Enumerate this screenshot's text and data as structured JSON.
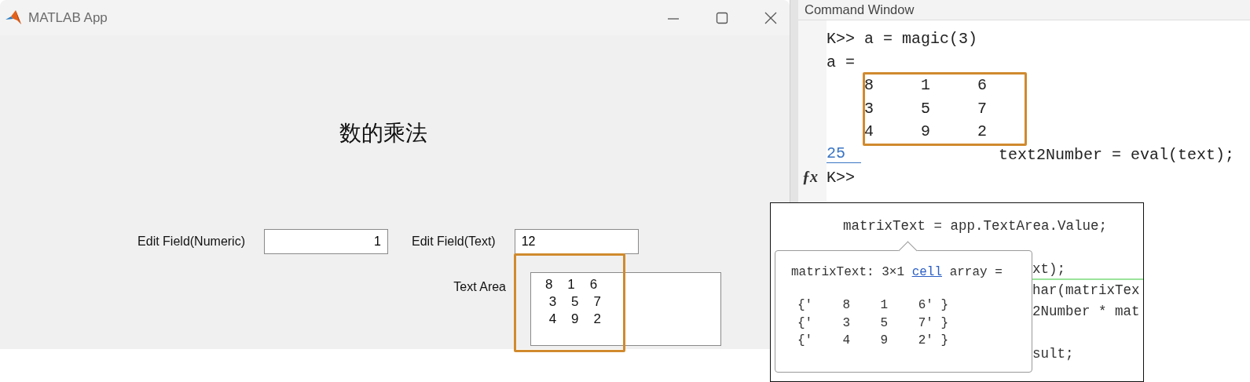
{
  "app_window": {
    "title": "MATLAB App",
    "heading": "数的乘法",
    "fields": [
      {
        "kind": "numeric",
        "label": "Edit Field(Numeric)",
        "value": "1"
      },
      {
        "kind": "text",
        "label": "Edit Field(Text)",
        "value": "12"
      }
    ],
    "text_area": {
      "label": "Text Area",
      "lines": [
        "8    1    6",
        " 3    5    7",
        " 4    9    2"
      ],
      "highlighted": true
    }
  },
  "command_window": {
    "title": "Command Window",
    "lines": [
      {
        "kind": "prompt",
        "text": "K>> a = magic(3)"
      },
      {
        "kind": "output",
        "text": "a ="
      },
      {
        "kind": "matrix",
        "rows": [
          [
            "8",
            "1",
            "6"
          ],
          [
            "3",
            "5",
            "7"
          ],
          [
            "4",
            "9",
            "2"
          ]
        ],
        "highlighted": true
      },
      {
        "kind": "link",
        "link": "25",
        "text": "text2Number = eval(text);"
      },
      {
        "kind": "fx_prompt",
        "fx": "ƒx",
        "text": "K>>"
      }
    ]
  },
  "code_snippet": {
    "lines": [
      "matrixText = app.TextArea.Value;"
    ],
    "fragments": [
      "xt);",
      "har(matrixTex",
      "2Number * mat",
      "sult;"
    ],
    "tooltip": {
      "title_before": "matrixText: 3×1",
      "title_link": "cell",
      "title_after": "array =",
      "rows": [
        "{'    8    1    6' }",
        "{'    3    5    7' }",
        "{'    4    9    2' }"
      ]
    }
  }
}
